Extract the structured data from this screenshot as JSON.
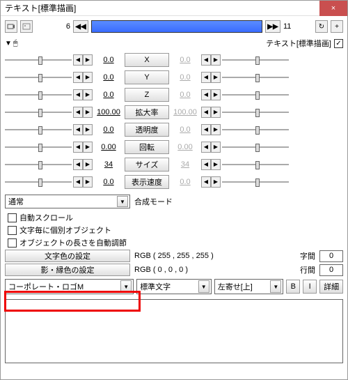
{
  "title": "テキスト[標準描画]",
  "timeline": {
    "start": 6,
    "end": 11
  },
  "header_label": "テキスト[標準描画]",
  "params": [
    {
      "name": "X",
      "left": "0.0",
      "right": "0.0",
      "dim": true
    },
    {
      "name": "Y",
      "left": "0.0",
      "right": "0.0",
      "dim": true
    },
    {
      "name": "Z",
      "left": "0.0",
      "right": "0.0",
      "dim": true
    },
    {
      "name": "拡大率",
      "left": "100.00",
      "right": "100.00",
      "dim": true
    },
    {
      "name": "透明度",
      "left": "0.0",
      "right": "0.0",
      "dim": true
    },
    {
      "name": "回転",
      "left": "0.00",
      "right": "0.00",
      "dim": true
    },
    {
      "name": "サイズ",
      "left": "34",
      "right": "34",
      "dim": true
    },
    {
      "name": "表示速度",
      "left": "0.0",
      "right": "0.0",
      "dim": true
    }
  ],
  "blend_label": "合成モード",
  "blend_value": "通常",
  "checks": [
    "自動スクロール",
    "文字毎に個別オブジェクト",
    "オブジェクトの長さを自動調節"
  ],
  "text_color_btn": "文字色の設定",
  "text_color_val": "RGB ( 255 , 255 , 255 )",
  "edge_color_btn": "影・縁色の設定",
  "edge_color_val": "RGB ( 0 , 0 , 0 )",
  "spacing_label": "字間",
  "spacing_val": "0",
  "line_label": "行間",
  "line_val": "0",
  "font": "コーポレート・ロゴM",
  "style": "標準文字",
  "align": "左寄せ[上]",
  "bold": "B",
  "italic": "I",
  "detail": "詳細"
}
